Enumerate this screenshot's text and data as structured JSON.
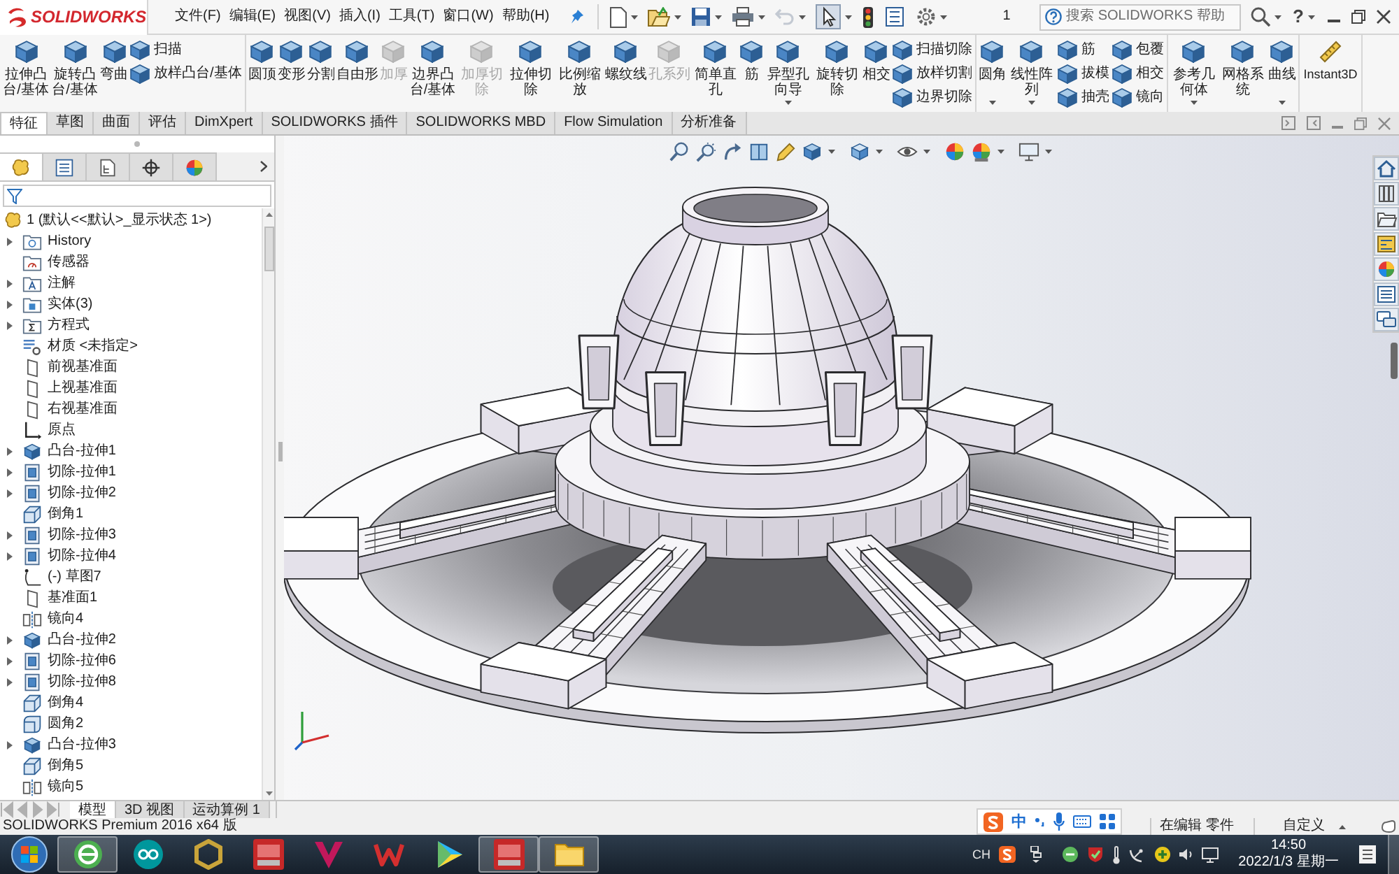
{
  "title_bar": {
    "logo": "SOLIDWORKS",
    "menu": [
      "文件(F)",
      "编辑(E)",
      "视图(V)",
      "插入(I)",
      "工具(T)",
      "窗口(W)",
      "帮助(H)"
    ],
    "help": "?"
  },
  "quick_access": {
    "undo": {
      "disabled": true
    },
    "select": {
      "pressed": true
    },
    "configuration": "1"
  },
  "help_search": {
    "placeholder": "搜索 SOLIDWORKS 帮助"
  },
  "ribbon": [
    [
      {
        "kind": "large",
        "label": "拉伸凸台/基体",
        "disabled": false
      },
      {
        "kind": "large",
        "label": "旋转凸台/基体",
        "disabled": false
      },
      {
        "kind": "large",
        "label": "弯曲",
        "disabled": false
      },
      {
        "kind": "stack",
        "items": [
          {
            "label": "扫描",
            "disabled": false
          },
          {
            "label": "放样凸台/基体",
            "disabled": false
          }
        ]
      }
    ],
    [
      {
        "kind": "large",
        "label": "圆顶",
        "disabled": false
      },
      {
        "kind": "large",
        "label": "变形",
        "disabled": false
      },
      {
        "kind": "large",
        "label": "分割",
        "disabled": false
      },
      {
        "kind": "large",
        "label": "自由形",
        "disabled": false
      },
      {
        "kind": "large",
        "label": "加厚",
        "disabled": true
      },
      {
        "kind": "large",
        "label": "边界凸台/基体",
        "disabled": false
      },
      {
        "kind": "large",
        "label": "加厚切除",
        "disabled": true
      },
      {
        "kind": "large",
        "label": "拉伸切除",
        "disabled": false
      },
      {
        "kind": "large",
        "label": "比例缩放",
        "disabled": false
      },
      {
        "kind": "large",
        "label": "螺纹线",
        "disabled": false
      },
      {
        "kind": "large",
        "label": "孔系列",
        "disabled": true
      },
      {
        "kind": "large",
        "label": "简单直孔",
        "disabled": false
      },
      {
        "kind": "large",
        "label": "筋",
        "disabled": false
      },
      {
        "kind": "split",
        "label": "异型孔向导",
        "disabled": false
      },
      {
        "kind": "large",
        "label": "旋转切除",
        "disabled": false
      },
      {
        "kind": "large",
        "label": "相交",
        "disabled": false
      },
      {
        "kind": "stack",
        "items": [
          {
            "label": "扫描切除",
            "disabled": false
          },
          {
            "label": "放样切割",
            "disabled": false
          },
          {
            "label": "边界切除",
            "disabled": false
          }
        ]
      }
    ],
    [
      {
        "kind": "split",
        "label": "圆角",
        "disabled": false
      },
      {
        "kind": "split",
        "label": "线性阵列",
        "disabled": false
      },
      {
        "kind": "stack",
        "items": [
          {
            "label": "筋",
            "disabled": false
          },
          {
            "label": "拔模",
            "disabled": false
          },
          {
            "label": "抽壳",
            "disabled": false
          }
        ]
      },
      {
        "kind": "stack",
        "items": [
          {
            "label": "包覆",
            "disabled": false
          },
          {
            "label": "相交",
            "disabled": false
          },
          {
            "label": "镜向",
            "disabled": false
          }
        ]
      }
    ],
    [
      {
        "kind": "split",
        "label": "参考几何体",
        "disabled": false
      },
      {
        "kind": "large",
        "label": "网格系统",
        "disabled": false
      },
      {
        "kind": "split",
        "label": "曲线",
        "disabled": false
      }
    ],
    [
      {
        "kind": "toggle",
        "label": "Instant3D",
        "disabled": false
      }
    ]
  ],
  "ribbon_tabs": [
    {
      "label": "特征",
      "selected": true
    },
    {
      "label": "草图",
      "selected": false
    },
    {
      "label": "曲面",
      "selected": false
    },
    {
      "label": "评估",
      "selected": false
    },
    {
      "label": "DimXpert",
      "selected": false
    },
    {
      "label": "SOLIDWORKS 插件",
      "selected": false
    },
    {
      "label": "SOLIDWORKS MBD",
      "selected": false
    },
    {
      "label": "Flow Simulation",
      "selected": false
    },
    {
      "label": "分析准备",
      "selected": false
    }
  ],
  "manager_tabs": [
    {
      "kind": "feature",
      "selected": true
    },
    {
      "kind": "property",
      "selected": false
    },
    {
      "kind": "configuration",
      "selected": false
    },
    {
      "kind": "dimxpert",
      "selected": false
    },
    {
      "kind": "display",
      "selected": false
    }
  ],
  "feature_tree": {
    "root": "1 (默认<<默认>_显示状态 1>)",
    "items": [
      {
        "label": "History",
        "kind": "history",
        "expandable": true
      },
      {
        "label": "传感器",
        "kind": "sensor",
        "expandable": false
      },
      {
        "label": "注解",
        "kind": "annotation",
        "expandable": true
      },
      {
        "label": "实体(3)",
        "kind": "solid",
        "expandable": true
      },
      {
        "label": "方程式",
        "kind": "equation",
        "expandable": true
      },
      {
        "label": "材质 <未指定>",
        "kind": "material",
        "expandable": false
      },
      {
        "label": "前视基准面",
        "kind": "plane",
        "expandable": false
      },
      {
        "label": "上视基准面",
        "kind": "plane",
        "expandable": false
      },
      {
        "label": "右视基准面",
        "kind": "plane",
        "expandable": false
      },
      {
        "label": "原点",
        "kind": "origin",
        "expandable": false
      },
      {
        "label": "凸台-拉伸1",
        "kind": "boss",
        "expandable": true
      },
      {
        "label": "切除-拉伸1",
        "kind": "cut",
        "expandable": true
      },
      {
        "label": "切除-拉伸2",
        "kind": "cut",
        "expandable": true
      },
      {
        "label": "倒角1",
        "kind": "chamfer",
        "expandable": false
      },
      {
        "label": "切除-拉伸3",
        "kind": "cut",
        "expandable": true
      },
      {
        "label": "切除-拉伸4",
        "kind": "cut",
        "expandable": true
      },
      {
        "label": "(-) 草图7",
        "kind": "sketch",
        "expandable": false
      },
      {
        "label": "基准面1",
        "kind": "plane",
        "expandable": false
      },
      {
        "label": "镜向4",
        "kind": "mirror",
        "expandable": false
      },
      {
        "label": "凸台-拉伸2",
        "kind": "boss",
        "expandable": true
      },
      {
        "label": "切除-拉伸6",
        "kind": "cut",
        "expandable": true
      },
      {
        "label": "切除-拉伸8",
        "kind": "cut",
        "expandable": true
      },
      {
        "label": "倒角4",
        "kind": "chamfer",
        "expandable": false
      },
      {
        "label": "圆角2",
        "kind": "fillet",
        "expandable": false
      },
      {
        "label": "凸台-拉伸3",
        "kind": "boss",
        "expandable": true
      },
      {
        "label": "倒角5",
        "kind": "chamfer",
        "expandable": false
      },
      {
        "label": "镜向5",
        "kind": "mirror",
        "expandable": false
      }
    ]
  },
  "bottom_tabs": [
    {
      "label": "模型",
      "selected": true
    },
    {
      "label": "3D 视图",
      "selected": false
    },
    {
      "label": "运动算例 1",
      "selected": false
    }
  ],
  "status_bar": {
    "product": "SOLIDWORKS Premium 2016 x64 版",
    "ime_mode": "中",
    "state": "在编辑 零件",
    "units": "自定义"
  },
  "taskbar": {
    "apps": [
      {
        "kind": "browser",
        "active": true
      },
      {
        "kind": "arduino",
        "active": false
      },
      {
        "kind": "gold",
        "active": false
      },
      {
        "kind": "sw",
        "active": false
      },
      {
        "kind": "red_v",
        "active": false
      },
      {
        "kind": "wps",
        "active": false
      },
      {
        "kind": "play",
        "active": false
      },
      {
        "kind": "sw",
        "active": true
      },
      {
        "kind": "folder",
        "active": true
      }
    ],
    "tray": {
      "language": "CH",
      "time": "14:50",
      "date": "2022/1/3 星期一"
    }
  }
}
